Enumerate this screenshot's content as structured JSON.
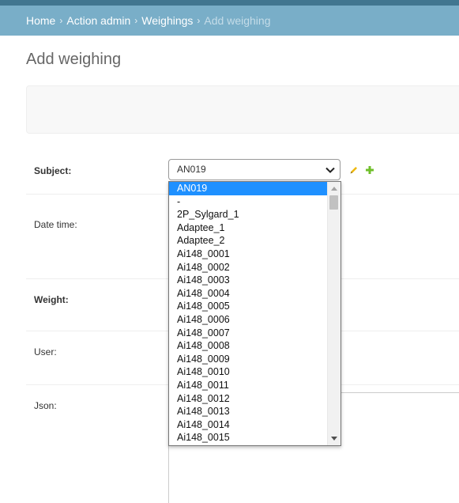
{
  "breadcrumbs": {
    "items": [
      "Home",
      "Action admin",
      "Weighings"
    ],
    "current": "Add weighing",
    "separator": "›"
  },
  "page": {
    "title": "Add weighing"
  },
  "form": {
    "subject_label": "Subject:",
    "subject_value": "AN019",
    "date_time_label": "Date time:",
    "weight_label": "Weight:",
    "user_label": "User:",
    "json_label": "Json:"
  },
  "dropdown": {
    "options": [
      "AN019",
      "-",
      "2P_Sylgard_1",
      "Adaptee_1",
      "Adaptee_2",
      "Ai148_0001",
      "Ai148_0002",
      "Ai148_0003",
      "Ai148_0004",
      "Ai148_0005",
      "Ai148_0006",
      "Ai148_0007",
      "Ai148_0008",
      "Ai148_0009",
      "Ai148_0010",
      "Ai148_0011",
      "Ai148_0012",
      "Ai148_0013",
      "Ai148_0014",
      "Ai148_0015"
    ],
    "selected": "AN019"
  },
  "icons": {
    "edit": "pencil-icon",
    "add": "plus-icon",
    "dropdown": "chevron-down-icon"
  },
  "colors": {
    "header": "#417690",
    "breadcrumb_bar": "#79aec8",
    "selected_option": "#1e90ff",
    "add_icon": "#70bf2b",
    "edit_icon": "#efb80b"
  }
}
